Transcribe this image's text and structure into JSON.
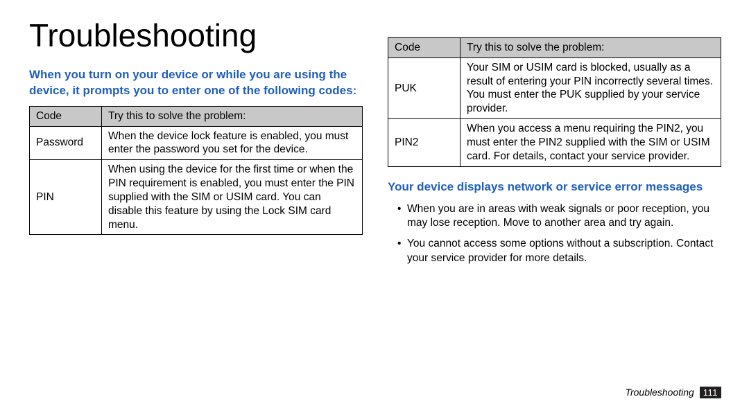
{
  "title": "Troubleshooting",
  "heading1": "When you turn on your device or while you are using the device, it prompts you to enter one of the following codes:",
  "table_header": {
    "code": "Code",
    "solve": "Try this to solve the problem:"
  },
  "rows_left": [
    {
      "code": "Password",
      "text": "When the device lock feature is enabled, you must enter the password you set for the device."
    },
    {
      "code": "PIN",
      "text": "When using the device for the ﬁrst time or when the PIN requirement is enabled, you must enter the PIN supplied with the SIM or USIM card. You can disable this feature by using the Lock SIM card menu."
    }
  ],
  "rows_right": [
    {
      "code": "PUK",
      "text": "Your SIM or USIM card is blocked, usually as a result of entering your PIN incorrectly several times. You must enter the PUK supplied by your service provider."
    },
    {
      "code": "PIN2",
      "text": "When you access a menu requiring the PIN2, you must enter the PIN2 supplied with the SIM or USIM card. For details, contact your service provider."
    }
  ],
  "heading2": "Your device displays network or service error messages",
  "bullets": [
    "When you are in areas with weak signals or poor reception, you may lose reception. Move to another area and try again.",
    "You cannot access some options without a subscription. Contact your service provider for more details."
  ],
  "footer_section": "Troubleshooting",
  "footer_page": "111"
}
